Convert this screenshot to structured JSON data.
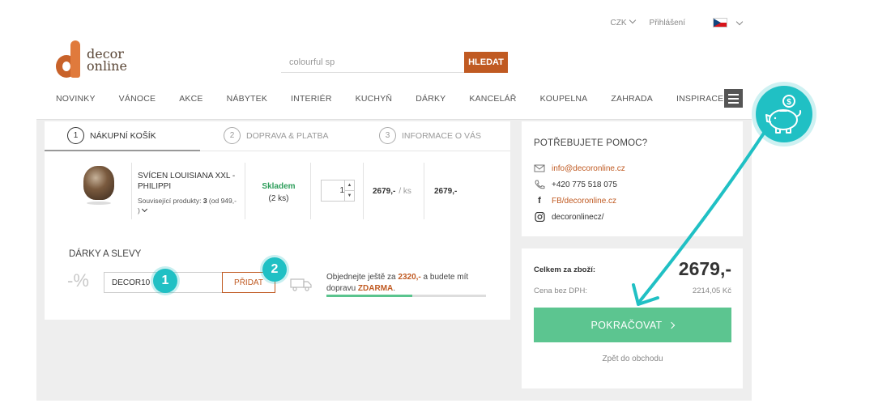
{
  "topbar": {
    "currency": "CZK",
    "login": "Přihlášení"
  },
  "logo": {
    "line1": "decor",
    "line2": "online"
  },
  "search": {
    "value": "colourful sp",
    "button": "HLEDAT"
  },
  "nav": [
    "NOVINKY",
    "VÁNOCE",
    "AKCE",
    "NÁBYTEK",
    "INTERIÉR",
    "KUCHYŇ",
    "DÁRKY",
    "KANCELÁŘ",
    "KOUPELNA",
    "ZAHRADA",
    "INSPIRACE"
  ],
  "steps": [
    {
      "num": "1",
      "label": "NÁKUPNÍ KOŠÍK"
    },
    {
      "num": "2",
      "label": "DOPRAVA & PLATBA"
    },
    {
      "num": "3",
      "label": "INFORMACE O VÁS"
    }
  ],
  "item": {
    "name": "SVÍCEN LOUISIANA XXL - PHILIPPI",
    "related_label": "Související produkty:",
    "related_count": "3",
    "related_from": "(od 949,-",
    "related_close": ")",
    "stock": "Skladem",
    "stock_count": "(2 ks)",
    "quantity": "1",
    "price": "2679,-",
    "price_unit": "/ ks",
    "total": "2679,-"
  },
  "gifts": {
    "title": "DÁRKY A SLEVY",
    "percent": "-%",
    "coupon_value": "DECOR10",
    "add_button": "PŘIDAT",
    "badge1": "1",
    "badge2": "2",
    "ship_pre": "Objednejte ještě za",
    "ship_amount": "2320,-",
    "ship_mid": "a budete mít dopravu",
    "ship_free": "ZDARMA",
    "ship_end": ".",
    "ship_progress": 0.54
  },
  "help": {
    "title": "POTŘEBUJETE POMOC?",
    "email": "info@decoronline.cz",
    "phone": "+420 775 518 075",
    "facebook": "FB/decoronline.cz",
    "instagram": "decoronlinecz/"
  },
  "summary": {
    "total_label": "Celkem za zboží:",
    "total_value": "2679,-",
    "net_label": "Cena bez DPH:",
    "net_value": "2214,05 Kč",
    "continue": "POKRAČOVAT",
    "back": "Zpět do obchodu"
  },
  "colors": {
    "accent": "#c05a22",
    "success": "#5cc590",
    "highlight": "#20c0c4"
  },
  "icons": {
    "piggy": "piggy-bank-icon",
    "truck": "truck-icon"
  }
}
